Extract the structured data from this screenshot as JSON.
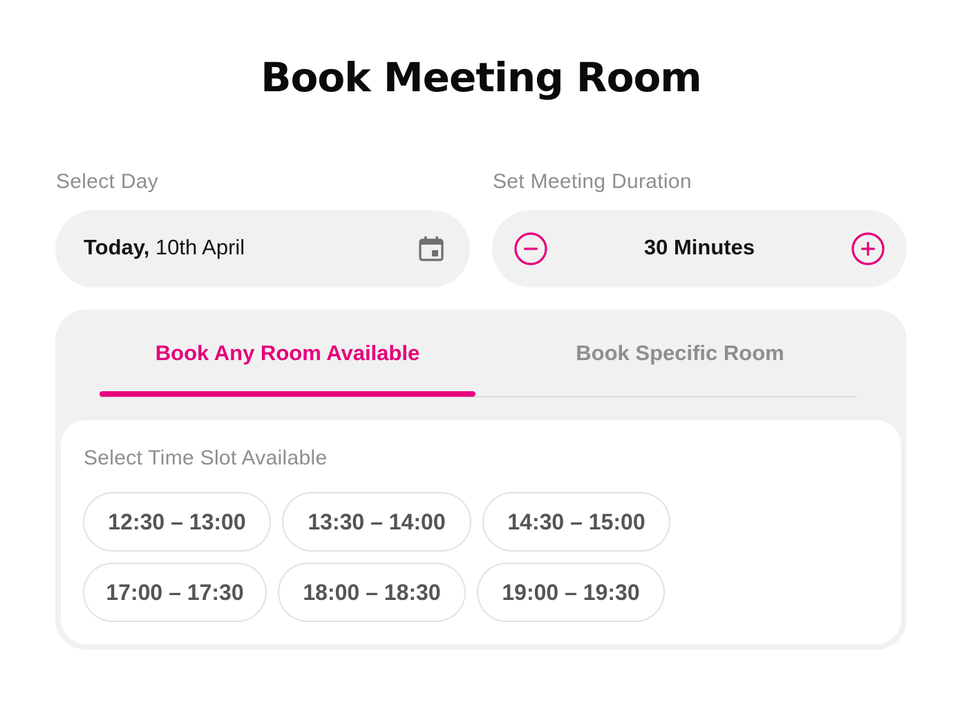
{
  "page": {
    "title": "Book Meeting Room"
  },
  "day": {
    "label": "Select Day",
    "prefix": "Today,",
    "date": " 10th April",
    "icon": "calendar-icon"
  },
  "duration": {
    "label": "Set Meeting Duration",
    "value": "30 Minutes",
    "decrease_icon": "minus-circle-icon",
    "increase_icon": "plus-circle-icon"
  },
  "tabs": [
    {
      "label": "Book Any Room Available",
      "active": true
    },
    {
      "label": "Book Specific Room",
      "active": false
    }
  ],
  "slots": {
    "label": "Select Time Slot Available",
    "items": [
      "12:30 – 13:00",
      "13:30 – 14:00",
      "14:30 – 15:00",
      "17:00 – 17:30",
      "18:00 – 18:30",
      "19:00 – 19:30"
    ]
  },
  "colors": {
    "accent": "#e6007a",
    "muted_text": "#8e8e8e",
    "pill_bg": "#f1f1f1",
    "slot_text": "#555555",
    "slot_border": "#e2e2e2"
  }
}
